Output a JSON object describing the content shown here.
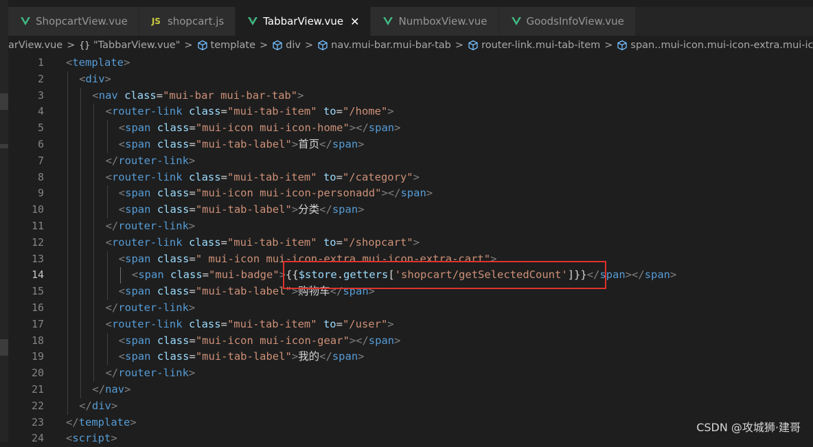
{
  "colors": {
    "tag": "#569cd6",
    "bracket": "#808080",
    "attribute": "#9cdcfe",
    "string": "#ce9178",
    "text": "#d4d4d4",
    "vue_icon": "#41b883",
    "js_icon": "#cbcb41",
    "highlight_box": "#e0322d"
  },
  "tabs": [
    {
      "icon": "vue-icon",
      "label": "ShopcartView.vue",
      "active": false
    },
    {
      "icon": "js-icon",
      "icon_text": "JS",
      "label": "shopcart.js",
      "active": false
    },
    {
      "icon": "vue-icon",
      "label": "TabbarView.vue",
      "active": true,
      "close": "✕"
    },
    {
      "icon": "vue-icon",
      "label": "NumboxView.vue",
      "active": false
    },
    {
      "icon": "vue-icon",
      "label": "GoodsInfoView.vue",
      "active": false
    }
  ],
  "breadcrumb": [
    {
      "icon": "none",
      "label": "arView.vue"
    },
    {
      "icon": "braces-icon",
      "icon_text": "{}",
      "label": "\"TabbarView.vue\""
    },
    {
      "icon": "cube-icon",
      "label": "template"
    },
    {
      "icon": "cube-icon",
      "label": "div"
    },
    {
      "icon": "cube-icon",
      "label": "nav.mui-bar.mui-bar-tab"
    },
    {
      "icon": "cube-icon",
      "label": "router-link.mui-tab-item"
    },
    {
      "icon": "cube-icon",
      "label": "span..mui-icon.mui-icon-extra.mui-ico"
    }
  ],
  "breadcrumb_separator": ">",
  "editor": {
    "current_line": 14,
    "lines": [
      {
        "n": "1",
        "indent": 0,
        "tokens": [
          [
            "br",
            "<"
          ],
          [
            "tag",
            "template"
          ],
          [
            "br",
            ">"
          ]
        ]
      },
      {
        "n": "2",
        "indent": 1,
        "tokens": [
          [
            "br",
            "<"
          ],
          [
            "tag",
            "div"
          ],
          [
            "br",
            ">"
          ]
        ]
      },
      {
        "n": "3",
        "indent": 2,
        "tokens": [
          [
            "br",
            "<"
          ],
          [
            "tag",
            "nav"
          ],
          [
            "txt",
            " "
          ],
          [
            "attr",
            "class"
          ],
          [
            "txt",
            "="
          ],
          [
            "str",
            "\"mui-bar mui-bar-tab\""
          ],
          [
            "br",
            ">"
          ]
        ]
      },
      {
        "n": "4",
        "indent": 3,
        "tokens": [
          [
            "br",
            "<"
          ],
          [
            "tag",
            "router-link"
          ],
          [
            "txt",
            " "
          ],
          [
            "attr",
            "class"
          ],
          [
            "txt",
            "="
          ],
          [
            "str",
            "\"mui-tab-item\""
          ],
          [
            "txt",
            " "
          ],
          [
            "attr",
            "to"
          ],
          [
            "txt",
            "="
          ],
          [
            "str",
            "\"/home\""
          ],
          [
            "br",
            ">"
          ]
        ]
      },
      {
        "n": "5",
        "indent": 4,
        "tokens": [
          [
            "br",
            "<"
          ],
          [
            "tag",
            "span"
          ],
          [
            "txt",
            " "
          ],
          [
            "attr",
            "class"
          ],
          [
            "txt",
            "="
          ],
          [
            "str",
            "\"mui-icon mui-icon-home\""
          ],
          [
            "br",
            "></"
          ],
          [
            "tag",
            "span"
          ],
          [
            "br",
            ">"
          ]
        ]
      },
      {
        "n": "6",
        "indent": 4,
        "tokens": [
          [
            "br",
            "<"
          ],
          [
            "tag",
            "span"
          ],
          [
            "txt",
            " "
          ],
          [
            "attr",
            "class"
          ],
          [
            "txt",
            "="
          ],
          [
            "str",
            "\"mui-tab-label\""
          ],
          [
            "br",
            ">"
          ],
          [
            "txt",
            "首页"
          ],
          [
            "br",
            "</"
          ],
          [
            "tag",
            "span"
          ],
          [
            "br",
            ">"
          ]
        ]
      },
      {
        "n": "7",
        "indent": 3,
        "tokens": [
          [
            "br",
            "</"
          ],
          [
            "tag",
            "router-link"
          ],
          [
            "br",
            ">"
          ]
        ]
      },
      {
        "n": "8",
        "indent": 3,
        "tokens": [
          [
            "br",
            "<"
          ],
          [
            "tag",
            "router-link"
          ],
          [
            "txt",
            " "
          ],
          [
            "attr",
            "class"
          ],
          [
            "txt",
            "="
          ],
          [
            "str",
            "\"mui-tab-item\""
          ],
          [
            "txt",
            " "
          ],
          [
            "attr",
            "to"
          ],
          [
            "txt",
            "="
          ],
          [
            "str",
            "\"/category\""
          ],
          [
            "br",
            ">"
          ]
        ]
      },
      {
        "n": "9",
        "indent": 4,
        "tokens": [
          [
            "br",
            "<"
          ],
          [
            "tag",
            "span"
          ],
          [
            "txt",
            " "
          ],
          [
            "attr",
            "class"
          ],
          [
            "txt",
            "="
          ],
          [
            "str",
            "\"mui-icon mui-icon-personadd\""
          ],
          [
            "br",
            "></"
          ],
          [
            "tag",
            "span"
          ],
          [
            "br",
            ">"
          ]
        ]
      },
      {
        "n": "10",
        "indent": 4,
        "tokens": [
          [
            "br",
            "<"
          ],
          [
            "tag",
            "span"
          ],
          [
            "txt",
            " "
          ],
          [
            "attr",
            "class"
          ],
          [
            "txt",
            "="
          ],
          [
            "str",
            "\"mui-tab-label\""
          ],
          [
            "br",
            ">"
          ],
          [
            "txt",
            "分类"
          ],
          [
            "br",
            "</"
          ],
          [
            "tag",
            "span"
          ],
          [
            "br",
            ">"
          ]
        ]
      },
      {
        "n": "11",
        "indent": 3,
        "tokens": [
          [
            "br",
            "</"
          ],
          [
            "tag",
            "router-link"
          ],
          [
            "br",
            ">"
          ]
        ]
      },
      {
        "n": "12",
        "indent": 3,
        "tokens": [
          [
            "br",
            "<"
          ],
          [
            "tag",
            "router-link"
          ],
          [
            "txt",
            " "
          ],
          [
            "attr",
            "class"
          ],
          [
            "txt",
            "="
          ],
          [
            "str",
            "\"mui-tab-item\""
          ],
          [
            "txt",
            " "
          ],
          [
            "attr",
            "to"
          ],
          [
            "txt",
            "="
          ],
          [
            "str",
            "\"/shopcart\""
          ],
          [
            "br",
            ">"
          ]
        ]
      },
      {
        "n": "13",
        "indent": 4,
        "tokens": [
          [
            "br",
            "<"
          ],
          [
            "tag",
            "span"
          ],
          [
            "txt",
            " "
          ],
          [
            "attr",
            "class"
          ],
          [
            "txt",
            "="
          ],
          [
            "str",
            "\" mui-icon mui-icon-extra mui-icon-extra-cart\""
          ],
          [
            "br",
            ">"
          ]
        ]
      },
      {
        "n": "14",
        "indent": 5,
        "tokens": [
          [
            "br",
            "<"
          ],
          [
            "tag",
            "span"
          ],
          [
            "txt",
            " "
          ],
          [
            "attr",
            "class"
          ],
          [
            "txt",
            "="
          ],
          [
            "str",
            "\"mui-badge\""
          ],
          [
            "br",
            ">"
          ],
          [
            "txt",
            "{{"
          ],
          [
            "var",
            "$store"
          ],
          [
            "txt",
            "."
          ],
          [
            "var",
            "getters"
          ],
          [
            "txt",
            "["
          ],
          [
            "str",
            "'shopcart/getSelectedCount'"
          ],
          [
            "txt",
            "]}}"
          ],
          [
            "br",
            "</"
          ],
          [
            "tag",
            "span"
          ],
          [
            "br",
            "></"
          ],
          [
            "tag",
            "span"
          ],
          [
            "br",
            ">"
          ]
        ]
      },
      {
        "n": "15",
        "indent": 4,
        "tokens": [
          [
            "br",
            "<"
          ],
          [
            "tag",
            "span"
          ],
          [
            "txt",
            " "
          ],
          [
            "attr",
            "class"
          ],
          [
            "txt",
            "="
          ],
          [
            "str",
            "\"mui-tab-label\""
          ],
          [
            "br",
            ">"
          ],
          [
            "txt",
            "购物车"
          ],
          [
            "br",
            "</"
          ],
          [
            "tag",
            "span"
          ],
          [
            "br",
            ">"
          ]
        ]
      },
      {
        "n": "16",
        "indent": 3,
        "tokens": [
          [
            "br",
            "</"
          ],
          [
            "tag",
            "router-link"
          ],
          [
            "br",
            ">"
          ]
        ]
      },
      {
        "n": "17",
        "indent": 3,
        "tokens": [
          [
            "br",
            "<"
          ],
          [
            "tag",
            "router-link"
          ],
          [
            "txt",
            " "
          ],
          [
            "attr",
            "class"
          ],
          [
            "txt",
            "="
          ],
          [
            "str",
            "\"mui-tab-item\""
          ],
          [
            "txt",
            " "
          ],
          [
            "attr",
            "to"
          ],
          [
            "txt",
            "="
          ],
          [
            "str",
            "\"/user\""
          ],
          [
            "br",
            ">"
          ]
        ]
      },
      {
        "n": "18",
        "indent": 4,
        "tokens": [
          [
            "br",
            "<"
          ],
          [
            "tag",
            "span"
          ],
          [
            "txt",
            " "
          ],
          [
            "attr",
            "class"
          ],
          [
            "txt",
            "="
          ],
          [
            "str",
            "\"mui-icon mui-icon-gear\""
          ],
          [
            "br",
            "></"
          ],
          [
            "tag",
            "span"
          ],
          [
            "br",
            ">"
          ]
        ]
      },
      {
        "n": "19",
        "indent": 4,
        "tokens": [
          [
            "br",
            "<"
          ],
          [
            "tag",
            "span"
          ],
          [
            "txt",
            " "
          ],
          [
            "attr",
            "class"
          ],
          [
            "txt",
            "="
          ],
          [
            "str",
            "\"mui-tab-label\""
          ],
          [
            "br",
            ">"
          ],
          [
            "txt",
            "我的"
          ],
          [
            "br",
            "</"
          ],
          [
            "tag",
            "span"
          ],
          [
            "br",
            ">"
          ]
        ]
      },
      {
        "n": "20",
        "indent": 3,
        "tokens": [
          [
            "br",
            "</"
          ],
          [
            "tag",
            "router-link"
          ],
          [
            "br",
            ">"
          ]
        ]
      },
      {
        "n": "21",
        "indent": 2,
        "tokens": [
          [
            "br",
            "</"
          ],
          [
            "tag",
            "nav"
          ],
          [
            "br",
            ">"
          ]
        ]
      },
      {
        "n": "22",
        "indent": 1,
        "tokens": [
          [
            "br",
            "</"
          ],
          [
            "tag",
            "div"
          ],
          [
            "br",
            ">"
          ]
        ]
      },
      {
        "n": "23",
        "indent": 0,
        "tokens": [
          [
            "br",
            "</"
          ],
          [
            "tag",
            "template"
          ],
          [
            "br",
            ">"
          ]
        ]
      },
      {
        "n": "24",
        "indent": 0,
        "tokens": [
          [
            "br",
            "<"
          ],
          [
            "tag",
            "script"
          ],
          [
            "br",
            ">"
          ]
        ]
      }
    ]
  },
  "watermark": "CSDN @攻城狮·建哥"
}
